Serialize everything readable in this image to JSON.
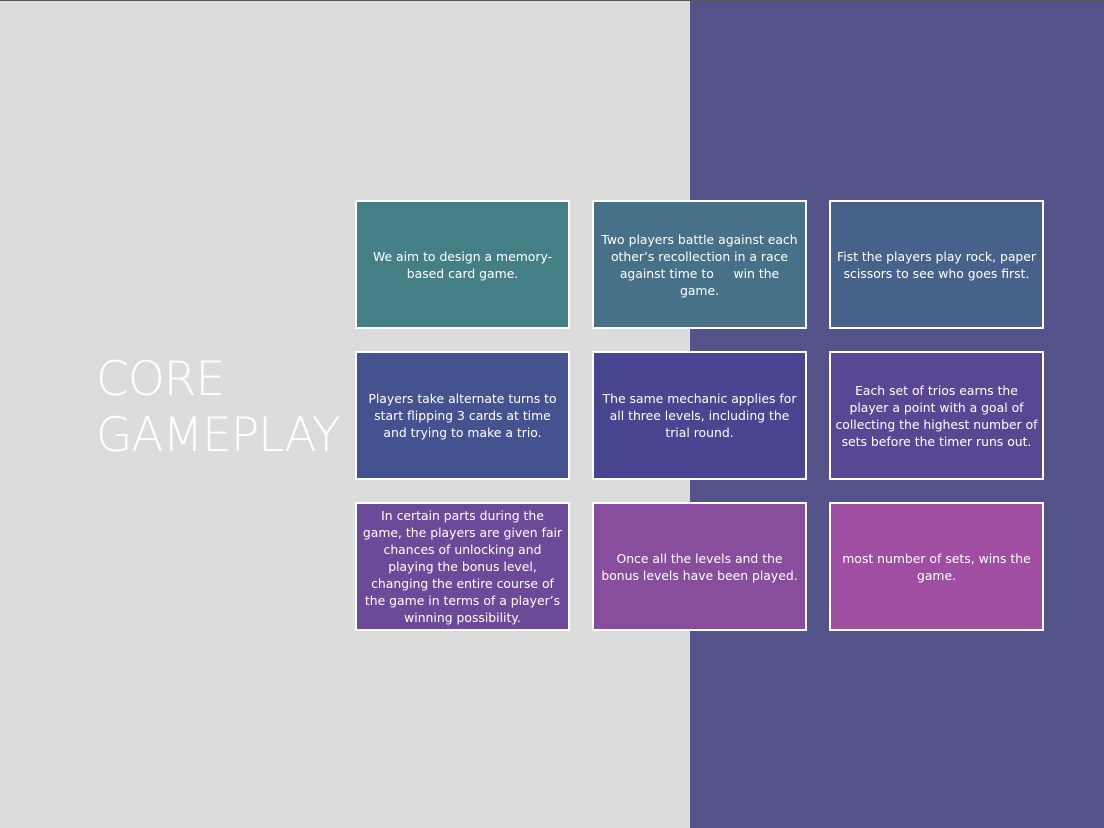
{
  "slide": {
    "title_line1": "CORE",
    "title_line2": "GAMEPLAY"
  },
  "cards": [
    {
      "text": "We aim to design a memory-based card game."
    },
    {
      "text": "Two players battle against each other’s recollection in a race against time to     win the game."
    },
    {
      "text": "Fist the players play rock, paper scissors to see who goes first."
    },
    {
      "text": "Players take alternate turns to start flipping 3 cards at time and trying to make a trio."
    },
    {
      "text": "The same mechanic applies for all three levels, including the trial round."
    },
    {
      "text": "Each set of trios earns the player a point with a goal of collecting the highest number of sets before the timer runs out."
    },
    {
      "text": "In certain parts during the game, the players are given fair chances of unlocking and playing the bonus level, changing the entire course of the game in terms of a player’s winning possibility."
    },
    {
      "text": "Once all the levels and the bonus levels have been played."
    },
    {
      "text": "most number of sets, wins the game."
    }
  ],
  "colors": {
    "background_left": "#dcdcdc",
    "background_right": "#535389",
    "card_border": "#ffffff",
    "card_gradient": [
      "#447f86",
      "#467189",
      "#46628a",
      "#445390",
      "#484591",
      "#5a4794",
      "#6b4a99",
      "#894d9d",
      "#a04ea2"
    ]
  }
}
